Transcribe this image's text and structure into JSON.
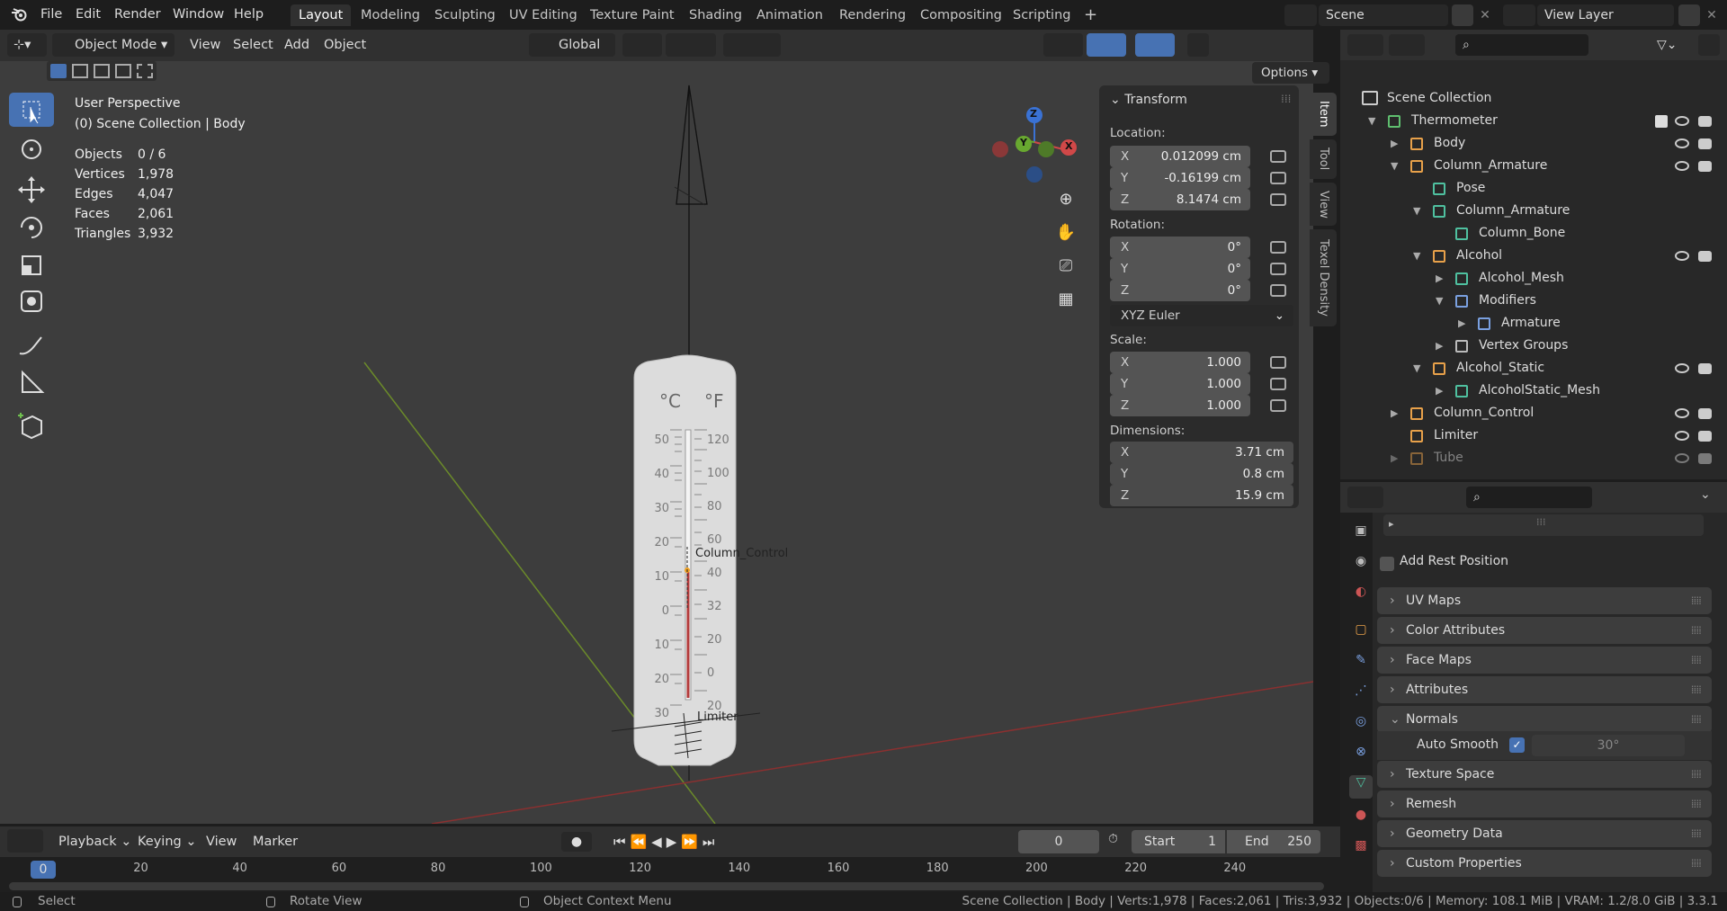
{
  "topbar": {
    "menus": [
      "File",
      "Edit",
      "Render",
      "Window",
      "Help"
    ],
    "workspaces": [
      "Layout",
      "Modeling",
      "Sculpting",
      "UV Editing",
      "Texture Paint",
      "Shading",
      "Animation",
      "Rendering",
      "Compositing",
      "Scripting"
    ],
    "active_workspace": "Layout",
    "plus": "+",
    "scene": "Scene",
    "view_layer": "View Layer"
  },
  "viewport_header": {
    "mode": "Object Mode",
    "menus": [
      "View",
      "Select",
      "Add",
      "Object"
    ],
    "transform_orientation": "Global",
    "options": "Options"
  },
  "viewport": {
    "perspective": "User Perspective",
    "collection": "(0) Scene Collection | Body",
    "stats": [
      {
        "label": "Objects",
        "value": "0 / 6"
      },
      {
        "label": "Vertices",
        "value": "1,978"
      },
      {
        "label": "Edges",
        "value": "4,047"
      },
      {
        "label": "Faces",
        "value": "2,061"
      },
      {
        "label": "Triangles",
        "value": "3,932"
      }
    ],
    "object_labels": {
      "column_control": "Column_Control",
      "limiter": "Limiter"
    },
    "thermometer": {
      "unit_c": "°C",
      "unit_f": "°F",
      "c_ticks": [
        "50",
        "40",
        "30",
        "20",
        "10",
        "0",
        "10",
        "20",
        "30"
      ],
      "f_ticks": [
        "120",
        "100",
        "80",
        "60",
        "40",
        "32",
        "20",
        "0",
        "20"
      ]
    },
    "gizmo": {
      "x": "X",
      "y": "Y",
      "z": "Z"
    }
  },
  "npanel": {
    "title": "Transform",
    "location_label": "Location:",
    "location": [
      {
        "axis": "X",
        "value": "0.012099 cm"
      },
      {
        "axis": "Y",
        "value": "-0.16199 cm"
      },
      {
        "axis": "Z",
        "value": "8.1474 cm"
      }
    ],
    "rotation_label": "Rotation:",
    "rotation": [
      {
        "axis": "X",
        "value": "0°"
      },
      {
        "axis": "Y",
        "value": "0°"
      },
      {
        "axis": "Z",
        "value": "0°"
      }
    ],
    "rotation_mode": "XYZ Euler",
    "scale_label": "Scale:",
    "scale": [
      {
        "axis": "X",
        "value": "1.000"
      },
      {
        "axis": "Y",
        "value": "1.000"
      },
      {
        "axis": "Z",
        "value": "1.000"
      }
    ],
    "dimensions_label": "Dimensions:",
    "dimensions": [
      {
        "axis": "X",
        "value": "3.71 cm"
      },
      {
        "axis": "Y",
        "value": "0.8 cm"
      },
      {
        "axis": "Z",
        "value": "15.9 cm"
      }
    ],
    "tabs": [
      "Item",
      "Tool",
      "View",
      "Texel Density"
    ]
  },
  "outliner": {
    "root": "Scene Collection",
    "items": [
      {
        "label": "Thermometer",
        "depth": 1,
        "color": "#5fbf6f"
      },
      {
        "label": "Body",
        "depth": 2,
        "color": "#e8a14a"
      },
      {
        "label": "Column_Armature",
        "depth": 2,
        "color": "#e8a14a"
      },
      {
        "label": "Pose",
        "depth": 3,
        "color": "#4fc1a0"
      },
      {
        "label": "Column_Armature",
        "depth": 3,
        "color": "#4fc1a0"
      },
      {
        "label": "Column_Bone",
        "depth": 4,
        "color": "#4fc1a0"
      },
      {
        "label": "Alcohol",
        "depth": 3,
        "color": "#e8a14a"
      },
      {
        "label": "Alcohol_Mesh",
        "depth": 4,
        "color": "#4fc1a0"
      },
      {
        "label": "Modifiers",
        "depth": 4,
        "color": "#7aa0e0"
      },
      {
        "label": "Armature",
        "depth": 5,
        "color": "#7aa0e0"
      },
      {
        "label": "Vertex Groups",
        "depth": 4,
        "color": "#bbbbbb"
      },
      {
        "label": "Alcohol_Static",
        "depth": 3,
        "color": "#e8a14a"
      },
      {
        "label": "AlcoholStatic_Mesh",
        "depth": 4,
        "color": "#4fc1a0"
      },
      {
        "label": "Column_Control",
        "depth": 2,
        "color": "#e8a14a"
      },
      {
        "label": "Limiter",
        "depth": 2,
        "color": "#e8a14a"
      },
      {
        "label": "Tube",
        "depth": 2,
        "color": "#e8a14a"
      }
    ]
  },
  "properties": {
    "checkbox_label": "Add Rest Position",
    "sections": [
      "UV Maps",
      "Color Attributes",
      "Face Maps",
      "Attributes",
      "Normals",
      "Texture Space",
      "Remesh",
      "Geometry Data",
      "Custom Properties"
    ],
    "auto_smooth_label": "Auto Smooth",
    "auto_smooth_angle": "30°"
  },
  "timeline": {
    "menus": [
      "Playback",
      "Keying",
      "View",
      "Marker"
    ],
    "current_frame": "0",
    "start_label": "Start",
    "start": "1",
    "end_label": "End",
    "end": "250",
    "ruler": [
      "0",
      "20",
      "40",
      "60",
      "80",
      "100",
      "120",
      "140",
      "160",
      "180",
      "200",
      "220",
      "240"
    ]
  },
  "status": {
    "select": "Select",
    "rotate": "Rotate View",
    "context": "Object Context Menu",
    "info": "Scene Collection | Body | Verts:1,978 | Faces:2,061 | Tris:3,932 | Objects:0/6 | Memory: 108.1 MiB | VRAM: 1.2/8.0 GiB | 3.3.1"
  }
}
